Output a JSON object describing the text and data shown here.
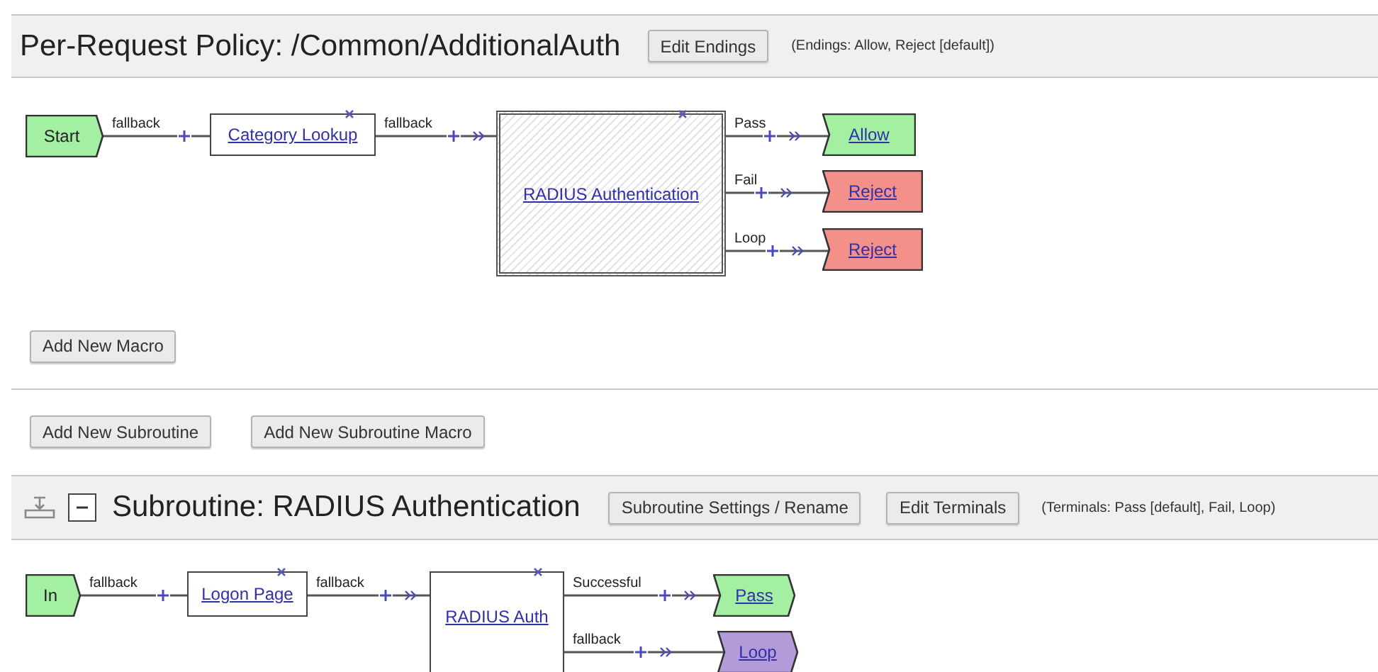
{
  "policy": {
    "title": "Per-Request Policy: /Common/AdditionalAuth",
    "edit_button": "Edit Endings",
    "note": "(Endings: Allow, Reject [default])",
    "nodes": [
      {
        "kind": "start",
        "label": "Start",
        "color": "#a3f0a3"
      },
      {
        "kind": "action",
        "label": "Category Lookup"
      },
      {
        "kind": "macro",
        "label": "RADIUS Authentication"
      },
      {
        "kind": "ending",
        "label": "Allow",
        "color": "#a3f0a3"
      },
      {
        "kind": "ending",
        "label": "Reject",
        "color": "#f4908a"
      },
      {
        "kind": "ending",
        "label": "Reject",
        "color": "#f4908a"
      }
    ],
    "branches": [
      {
        "label": "fallback"
      },
      {
        "label": "fallback"
      },
      {
        "label": "Pass"
      },
      {
        "label": "Fail"
      },
      {
        "label": "Loop"
      }
    ]
  },
  "macro_button": "Add New Macro",
  "subroutine_buttons": [
    "Add New Subroutine",
    "Add New Subroutine Macro"
  ],
  "subroutine": {
    "title": "Subroutine: RADIUS Authentication",
    "expanded": true,
    "buttons": [
      "Subroutine Settings / Rename",
      "Edit Terminals"
    ],
    "note": "(Terminals: Pass [default], Fail, Loop)",
    "nodes": [
      {
        "kind": "start",
        "label": "In",
        "color": "#a3f0a3"
      },
      {
        "kind": "action",
        "label": "Logon Page"
      },
      {
        "kind": "call",
        "label": "RADIUS Auth"
      },
      {
        "kind": "terminal",
        "label": "Pass",
        "color": "#a3f0a3"
      },
      {
        "kind": "terminal",
        "label": "Loop",
        "color": "#b39ad8"
      }
    ],
    "branches": [
      {
        "label": "fallback"
      },
      {
        "label": "fallback"
      },
      {
        "label": "Successful"
      },
      {
        "label": "fallback"
      }
    ]
  }
}
